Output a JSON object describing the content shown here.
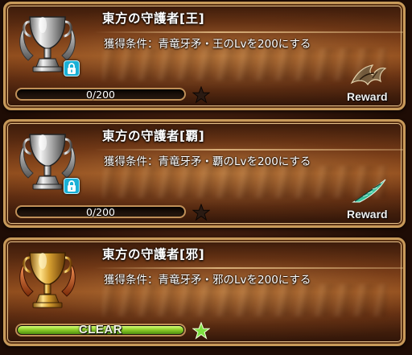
{
  "achievements": [
    {
      "title": "東方の守護者[王]",
      "condition": "獲得条件：青竜牙矛・王のLvを200にする",
      "progress_text": "0/200",
      "progress_fraction": 0.0,
      "reward_label": "Reward",
      "trophy": "silver-trophy-icon",
      "locked": true,
      "reward_icon": "dragon-wing-icon"
    },
    {
      "title": "東方の守護者[覇]",
      "condition": "獲得条件：青竜牙矛・覇のLvを200にする",
      "progress_text": "0/200",
      "progress_fraction": 0.0,
      "reward_label": "Reward",
      "trophy": "silver-trophy-icon",
      "locked": true,
      "reward_icon": "feather-blade-icon"
    },
    {
      "title": "東方の守護者[邪]",
      "condition": "獲得条件：青竜牙矛・邪のLvを200にする",
      "progress_text": "CLEAR",
      "progress_fraction": 1.0,
      "trophy": "gold-trophy-icon",
      "locked": false
    }
  ],
  "colors": {
    "frame": "#c89a5a",
    "progress_green": "#8ed02a",
    "lock_blue": "#1ab0d6",
    "star_dark": "#2a1a12",
    "star_green": "#7ee040"
  }
}
